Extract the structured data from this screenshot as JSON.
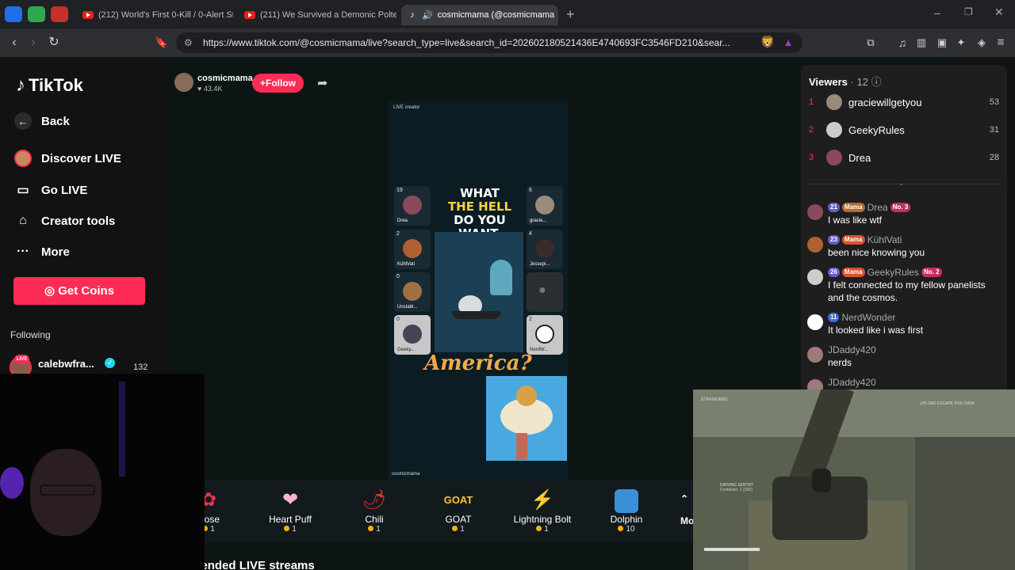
{
  "browser": {
    "tabs": [
      {
        "title": "(212) World's First 0-Kill / 0-Alert Ste"
      },
      {
        "title": "(211) We Survived a Demonic Polterg"
      },
      {
        "title": "cosmicmama (@cosmicmama"
      }
    ],
    "url": "https://www.tiktok.com/@cosmicmama/live?search_type=live&search_id=202602180521436E4740693FC3546FD210&sear..."
  },
  "sidebar": {
    "logo": "TikTok",
    "back_label": "Back",
    "items": [
      {
        "label": "Discover LIVE"
      },
      {
        "label": "Go LIVE"
      },
      {
        "label": "Creator tools"
      },
      {
        "label": "More"
      }
    ],
    "get_coins_label": "Get Coins",
    "following_title": "Following",
    "following": [
      {
        "name": "calebwfra...",
        "badge": "LIVE",
        "count": "132"
      }
    ]
  },
  "stream": {
    "host": "cosmicmama",
    "likes": "43.4K",
    "follow_label": "Follow",
    "live_tag": "LIVE creator",
    "overlay_line1": "WHAT",
    "overlay_line2": "THE HELL",
    "overlay_line3": "DO YOU WANT,",
    "overlay_script": "America?",
    "watermark": "cosmicmama",
    "seats": [
      {
        "count": "19",
        "name": "Drea"
      },
      {
        "count": "6",
        "name": "gracie..."
      },
      {
        "count": "2",
        "name": "KühlVati"
      },
      {
        "count": "4",
        "name": "Jessepi..."
      },
      {
        "count": "0",
        "name": "Unstabl..."
      },
      {
        "count": "0",
        "name": "Geeky..."
      },
      {
        "count": "2",
        "name": "NerdW..."
      }
    ]
  },
  "gifts": {
    "items": [
      {
        "name": "Rose",
        "price": "1",
        "icon": "rose-icon"
      },
      {
        "name": "Heart Puff",
        "price": "1",
        "icon": "heart-puff-icon"
      },
      {
        "name": "Chili",
        "price": "1",
        "icon": "chili-icon"
      },
      {
        "name": "GOAT",
        "price": "1",
        "icon": "goat-icon"
      },
      {
        "name": "Lightning Bolt",
        "price": "1",
        "icon": "lightning-icon"
      },
      {
        "name": "Dolphin",
        "price": "10",
        "icon": "dolphin-icon"
      }
    ],
    "more_label": "More"
  },
  "recommended_title": "Recommended LIVE streams",
  "viewers": {
    "title": "Viewers",
    "count": "· 12",
    "top": [
      {
        "rank": "1",
        "name": "graciewillgetyou",
        "score": "53"
      },
      {
        "rank": "2",
        "name": "GeekyRules",
        "score": "31"
      },
      {
        "rank": "3",
        "name": "Drea",
        "score": "28"
      }
    ]
  },
  "chat": [
    {
      "level": "21",
      "team": "Mama",
      "name": "Drea",
      "rank": "No. 3",
      "text": "I was like wtf"
    },
    {
      "level": "23",
      "team": "Mama",
      "name": "KühlVati",
      "rank": "",
      "text": "been nice knowing you"
    },
    {
      "level": "26",
      "team": "Mama",
      "name": "GeekyRules",
      "rank": "No. 2",
      "text": "I felt connected to my fellow panelists and the cosmos."
    },
    {
      "level": "11",
      "team": "",
      "name": "NerdWonder",
      "rank": "",
      "text": "It looked like i was first"
    },
    {
      "level": "",
      "team": "",
      "name": "JDaddy420",
      "rank": "",
      "text": "nerds"
    },
    {
      "level": "",
      "team": "",
      "name": "JDaddy420",
      "rank": "",
      "text": ""
    }
  ],
  "game_overlay": {
    "hud_top": "STRATAGEMS",
    "hud_right": "UPLOAD ESCAPE POD DATA",
    "weapon": "DRIVING SENTRY",
    "cooldown": "Cooldown: 1 (300)"
  },
  "colors": {
    "accent": "#fe2c55",
    "coin": "#f7b500"
  }
}
